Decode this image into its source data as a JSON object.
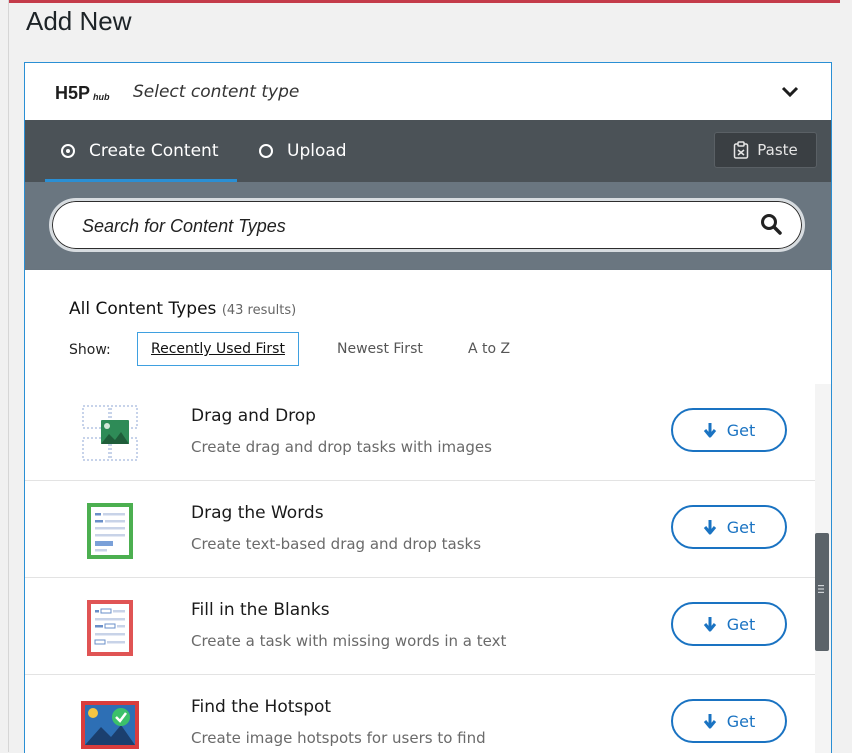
{
  "page": {
    "title": "Add New"
  },
  "hub": {
    "logo": "H5P hub",
    "title": "Select content type",
    "chevron_icon": "chevron-down-icon"
  },
  "tabs": [
    {
      "label": "Create Content",
      "selected": true
    },
    {
      "label": "Upload",
      "selected": false
    }
  ],
  "paste": {
    "label": "Paste",
    "icon": "clipboard-icon"
  },
  "search": {
    "placeholder": "Search for Content Types",
    "icon": "search-icon"
  },
  "filter": {
    "heading": "All Content Types",
    "count": "(43 results)",
    "show_label": "Show:",
    "options": [
      "Recently Used First",
      "Newest First",
      "A to Z"
    ],
    "selected": "Recently Used First"
  },
  "items": [
    {
      "title": "Drag and Drop",
      "description": "Create drag and drop tasks with images",
      "button": "Get",
      "icon": "drag-and-drop-icon"
    },
    {
      "title": "Drag the Words",
      "description": "Create text-based drag and drop tasks",
      "button": "Get",
      "icon": "drag-the-words-icon"
    },
    {
      "title": "Fill in the Blanks",
      "description": "Create a task with missing words in a text",
      "button": "Get",
      "icon": "fill-in-the-blanks-icon"
    },
    {
      "title": "Find the Hotspot",
      "description": "Create image hotspots for users to find",
      "button": "Get",
      "icon": "find-the-hotspot-icon"
    }
  ],
  "colors": {
    "accent": "#1a73c2",
    "tabbar": "#4b5257",
    "search_area": "#6a7680",
    "top_strip": "#c43b4a"
  }
}
